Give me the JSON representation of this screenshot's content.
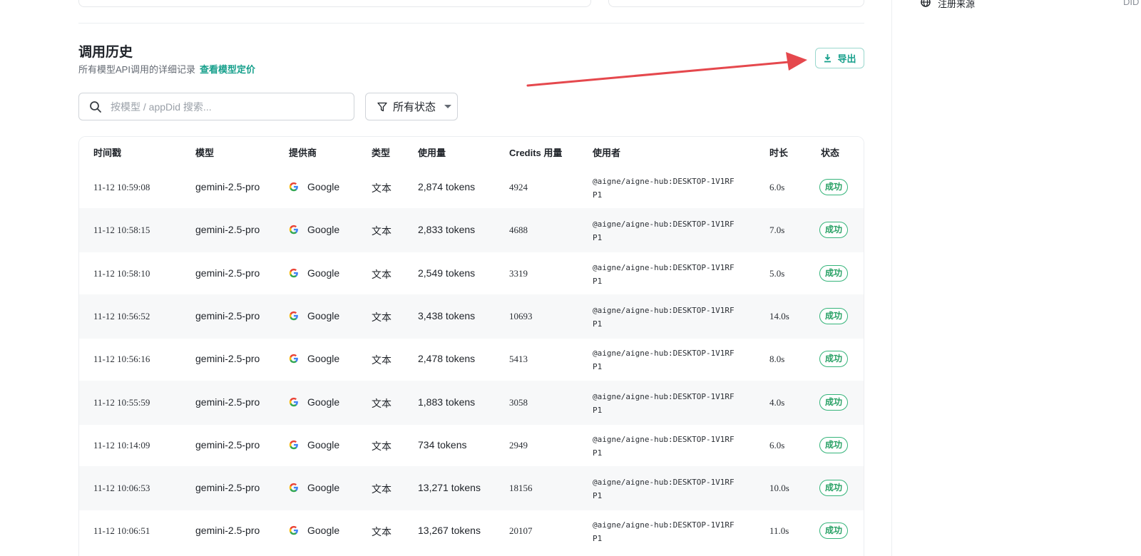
{
  "sidebar": {
    "label": "注册来源",
    "value": "DID Wallet"
  },
  "history": {
    "title": "调用历史",
    "description": "所有模型API调用的详细记录",
    "pricing_link": "查看模型定价",
    "export_label": "导出"
  },
  "filters": {
    "search_placeholder": "按模型 / appDid 搜索...",
    "status_label": "所有状态"
  },
  "table": {
    "columns": [
      "时间戳",
      "模型",
      "提供商",
      "类型",
      "使用量",
      "Credits 用量",
      "使用者",
      "时长",
      "状态"
    ],
    "rows": [
      {
        "timestamp": "11-12 10:59:08",
        "model": "gemini-2.5-pro",
        "provider": "Google",
        "type": "文本",
        "usage": "2,874 tokens",
        "credits": "4924",
        "user": "@aigne/aigne-hub:DESKTOP-1V1RFP1",
        "duration": "6.0s",
        "status": "成功"
      },
      {
        "timestamp": "11-12 10:58:15",
        "model": "gemini-2.5-pro",
        "provider": "Google",
        "type": "文本",
        "usage": "2,833 tokens",
        "credits": "4688",
        "user": "@aigne/aigne-hub:DESKTOP-1V1RFP1",
        "duration": "7.0s",
        "status": "成功"
      },
      {
        "timestamp": "11-12 10:58:10",
        "model": "gemini-2.5-pro",
        "provider": "Google",
        "type": "文本",
        "usage": "2,549 tokens",
        "credits": "3319",
        "user": "@aigne/aigne-hub:DESKTOP-1V1RFP1",
        "duration": "5.0s",
        "status": "成功"
      },
      {
        "timestamp": "11-12 10:56:52",
        "model": "gemini-2.5-pro",
        "provider": "Google",
        "type": "文本",
        "usage": "3,438 tokens",
        "credits": "10693",
        "user": "@aigne/aigne-hub:DESKTOP-1V1RFP1",
        "duration": "14.0s",
        "status": "成功"
      },
      {
        "timestamp": "11-12 10:56:16",
        "model": "gemini-2.5-pro",
        "provider": "Google",
        "type": "文本",
        "usage": "2,478 tokens",
        "credits": "5413",
        "user": "@aigne/aigne-hub:DESKTOP-1V1RFP1",
        "duration": "8.0s",
        "status": "成功"
      },
      {
        "timestamp": "11-12 10:55:59",
        "model": "gemini-2.5-pro",
        "provider": "Google",
        "type": "文本",
        "usage": "1,883 tokens",
        "credits": "3058",
        "user": "@aigne/aigne-hub:DESKTOP-1V1RFP1",
        "duration": "4.0s",
        "status": "成功"
      },
      {
        "timestamp": "11-12 10:14:09",
        "model": "gemini-2.5-pro",
        "provider": "Google",
        "type": "文本",
        "usage": "734 tokens",
        "credits": "2949",
        "user": "@aigne/aigne-hub:DESKTOP-1V1RFP1",
        "duration": "6.0s",
        "status": "成功"
      },
      {
        "timestamp": "11-12 10:06:53",
        "model": "gemini-2.5-pro",
        "provider": "Google",
        "type": "文本",
        "usage": "13,271 tokens",
        "credits": "18156",
        "user": "@aigne/aigne-hub:DESKTOP-1V1RFP1",
        "duration": "10.0s",
        "status": "成功"
      },
      {
        "timestamp": "11-12 10:06:51",
        "model": "gemini-2.5-pro",
        "provider": "Google",
        "type": "文本",
        "usage": "13,267 tokens",
        "credits": "20107",
        "user": "@aigne/aigne-hub:DESKTOP-1V1RFP1",
        "duration": "11.0s",
        "status": "成功"
      }
    ]
  },
  "colors": {
    "accent": "#17a08c",
    "success": "#27a064",
    "annotation_arrow": "#e5484d"
  }
}
